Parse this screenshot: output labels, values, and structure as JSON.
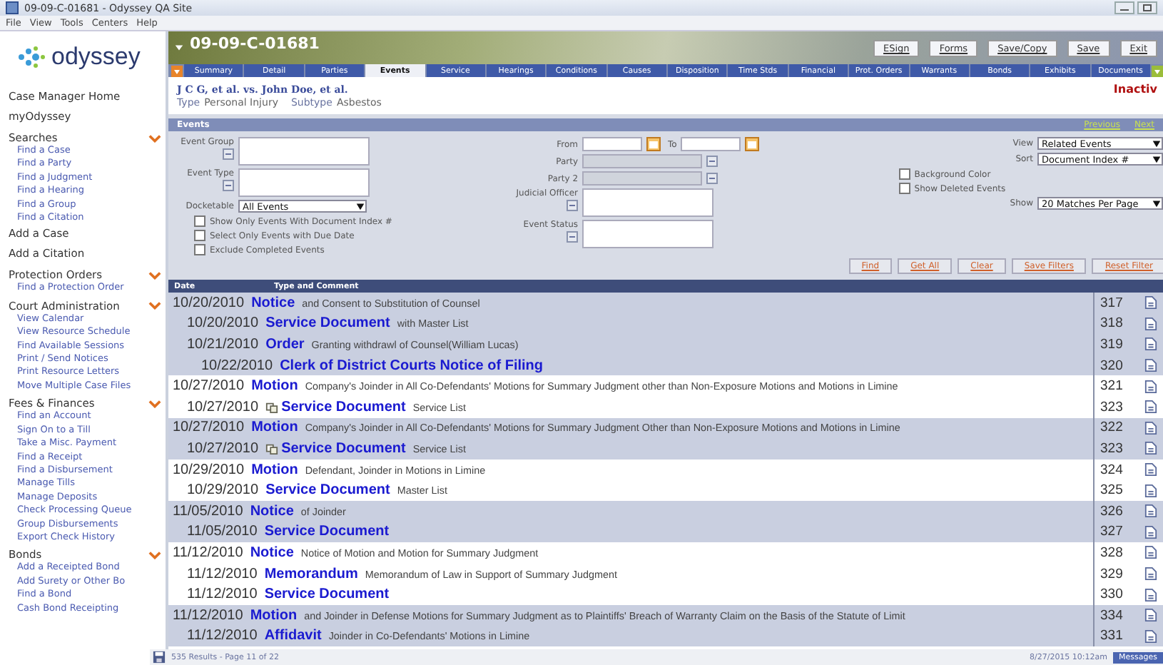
{
  "window": {
    "title": "09-09-C-01681 - Odyssey QA Site"
  },
  "menu": [
    "File",
    "View",
    "Tools",
    "Centers",
    "Help"
  ],
  "logo": {
    "text": "odyssey"
  },
  "sidebar": [
    {
      "kind": "top",
      "label": "Case Manager Home"
    },
    {
      "kind": "top",
      "label": "myOdyssey"
    },
    {
      "kind": "section",
      "label": "Searches",
      "expanded": true,
      "links": [
        "Find a Case",
        "Find a Party",
        "Find a Judgment",
        "Find a Hearing",
        "Find a Group",
        "Find a Citation"
      ]
    },
    {
      "kind": "top",
      "label": "Add a Case"
    },
    {
      "kind": "top",
      "label": "Add a Citation"
    },
    {
      "kind": "section",
      "label": "Protection Orders",
      "expanded": true,
      "links": [
        "Find a Protection Order"
      ]
    },
    {
      "kind": "section",
      "label": "Court Administration",
      "expanded": true,
      "links": [
        "View Calendar",
        "View Resource Schedule",
        "Find Available Sessions",
        "Print / Send Notices",
        "Print Resource Letters",
        "Move Multiple Case Files"
      ]
    },
    {
      "kind": "section",
      "label": "Fees & Finances",
      "expanded": true,
      "links": [
        "Find an Account",
        "Sign On to a Till",
        "Take a Misc. Payment",
        "Find a Receipt",
        "Find a Disbursement",
        "Manage Tills",
        "Manage Deposits",
        "Check Processing Queue",
        "Group Disbursements",
        "Export Check History"
      ]
    },
    {
      "kind": "section",
      "label": "Bonds",
      "expanded": true,
      "links": [
        "Add a Receipted Bond",
        "Add Surety or Other Bo",
        "Find a Bond",
        "Cash Bond Receipting"
      ]
    }
  ],
  "case": {
    "number": "09-09-C-01681",
    "buttons": [
      "ESign",
      "Forms",
      "Save/Copy",
      "Save",
      "Exit"
    ],
    "title": "J C G, et al. vs. John Doe, et al.",
    "type_label": "Type",
    "type": "Personal Injury",
    "subtype_label": "Subtype",
    "subtype": "Asbestos",
    "status": "Inactiv"
  },
  "tabs": [
    {
      "label": "Summary",
      "selected": false
    },
    {
      "label": "Detail",
      "selected": false
    },
    {
      "label": "Parties",
      "selected": false
    },
    {
      "label": "Events",
      "selected": true
    },
    {
      "label": "Service",
      "selected": false
    },
    {
      "label": "Hearings",
      "selected": false
    },
    {
      "label": "Conditions",
      "selected": false
    },
    {
      "label": "Causes",
      "selected": false
    },
    {
      "label": "Disposition",
      "selected": false
    },
    {
      "label": "Time Stds",
      "selected": false
    },
    {
      "label": "Financial",
      "selected": false
    },
    {
      "label": "Prot. Orders",
      "selected": false
    },
    {
      "label": "Warrants",
      "selected": false
    },
    {
      "label": "Bonds",
      "selected": false
    },
    {
      "label": "Exhibits",
      "selected": false
    },
    {
      "label": "Documents",
      "selected": false
    }
  ],
  "events_bar": {
    "title": "Events",
    "previous": "Previous",
    "next": "Next"
  },
  "filters": {
    "event_group": "Event Group",
    "event_type": "Event Type",
    "docketable_label": "Docketable",
    "docketable": "All Events",
    "checks": [
      {
        "label": "Show Only Events With Document Index #",
        "checked": false
      },
      {
        "label": "Select Only Events with Due Date",
        "checked": false
      },
      {
        "label": "Exclude Completed Events",
        "checked": false
      }
    ],
    "from": "From",
    "to": "To",
    "party": "Party",
    "party2": "Party 2",
    "judicial_officer": "Judicial Officer",
    "event_status": "Event Status",
    "view_label": "View",
    "view": "Related Events",
    "sort_label": "Sort",
    "sort": "Document Index #",
    "options": [
      {
        "label": "Background Color",
        "checked": false
      },
      {
        "label": "Show Deleted Events",
        "checked": false
      }
    ],
    "show_label": "Show",
    "show": "20 Matches Per Page",
    "buttons": [
      "Find",
      "Get All",
      "Clear",
      "Save Filters",
      "Reset Filter"
    ]
  },
  "table": {
    "columns": [
      "Date",
      "Type and Comment"
    ],
    "rows": [
      {
        "date": "10/20/2010",
        "type": "Notice",
        "comment": "and Consent to Substitution of Counsel",
        "index": "317",
        "linked": false,
        "children": [
          {
            "date": "10/20/2010",
            "type": "Service Document",
            "comment": "with Master List",
            "index": "318",
            "linked": false
          },
          {
            "date": "10/21/2010",
            "type": "Order",
            "comment": "Granting withdrawl of Counsel(William Lucas)",
            "index": "319",
            "linked": false,
            "children": [
              {
                "date": "10/22/2010",
                "type": "Clerk of District Courts Notice of Filing",
                "index": "320",
                "linked": false
              }
            ]
          }
        ]
      },
      {
        "date": "10/27/2010",
        "type": "Motion",
        "comment": "Company's Joinder in All Co-Defendants' Motions for Summary Judgment other than Non-Exposure Motions and Motions in Limine",
        "index": "321",
        "linked": false,
        "children": [
          {
            "date": "10/27/2010",
            "type": "Service Document",
            "comment": "Service List",
            "index": "323",
            "linked": true
          }
        ]
      },
      {
        "date": "10/27/2010",
        "type": "Motion",
        "comment": "Company's Joinder in All Co-Defendants' Motions for Summary Judgment Other than Non-Exposure Motions and Motions in Limine",
        "index": "322",
        "linked": false,
        "children": [
          {
            "date": "10/27/2010",
            "type": "Service Document",
            "comment": "Service List",
            "index": "323",
            "linked": true
          }
        ]
      },
      {
        "date": "10/29/2010",
        "type": "Motion",
        "comment": "Defendant, Joinder in Motions in Limine",
        "index": "324",
        "linked": false,
        "children": [
          {
            "date": "10/29/2010",
            "type": "Service Document",
            "comment": "Master List",
            "index": "325",
            "linked": false
          }
        ]
      },
      {
        "date": "11/05/2010",
        "type": "Notice",
        "comment": "of Joinder",
        "index": "326",
        "linked": false,
        "children": [
          {
            "date": "11/05/2010",
            "type": "Service Document",
            "index": "327",
            "linked": false
          }
        ]
      },
      {
        "date": "11/12/2010",
        "type": "Notice",
        "comment": "Notice of Motion and Motion for Summary Judgment",
        "index": "328",
        "linked": false,
        "children": [
          {
            "date": "11/12/2010",
            "type": "Memorandum",
            "comment": "Memorandum of Law in Support of Summary Judgment",
            "index": "329",
            "linked": false
          },
          {
            "date": "11/12/2010",
            "type": "Service Document",
            "index": "330",
            "linked": false
          }
        ]
      },
      {
        "date": "11/12/2010",
        "type": "Motion",
        "comment": "and Joinder in Defense Motions for Summary Judgment as to Plaintiffs' Breach of Warranty Claim on the Basis of the Statute of Limit",
        "index": "334",
        "linked": false,
        "children": [
          {
            "date": "11/12/2010",
            "type": "Affidavit",
            "comment": "Joinder in Co-Defendants' Motions in Limine",
            "index": "331",
            "linked": false
          }
        ]
      }
    ]
  },
  "status_bar": {
    "results": "535 Results - Page 11 of 22",
    "time": "8/27/2015 10:12am",
    "messages": "Messages"
  }
}
